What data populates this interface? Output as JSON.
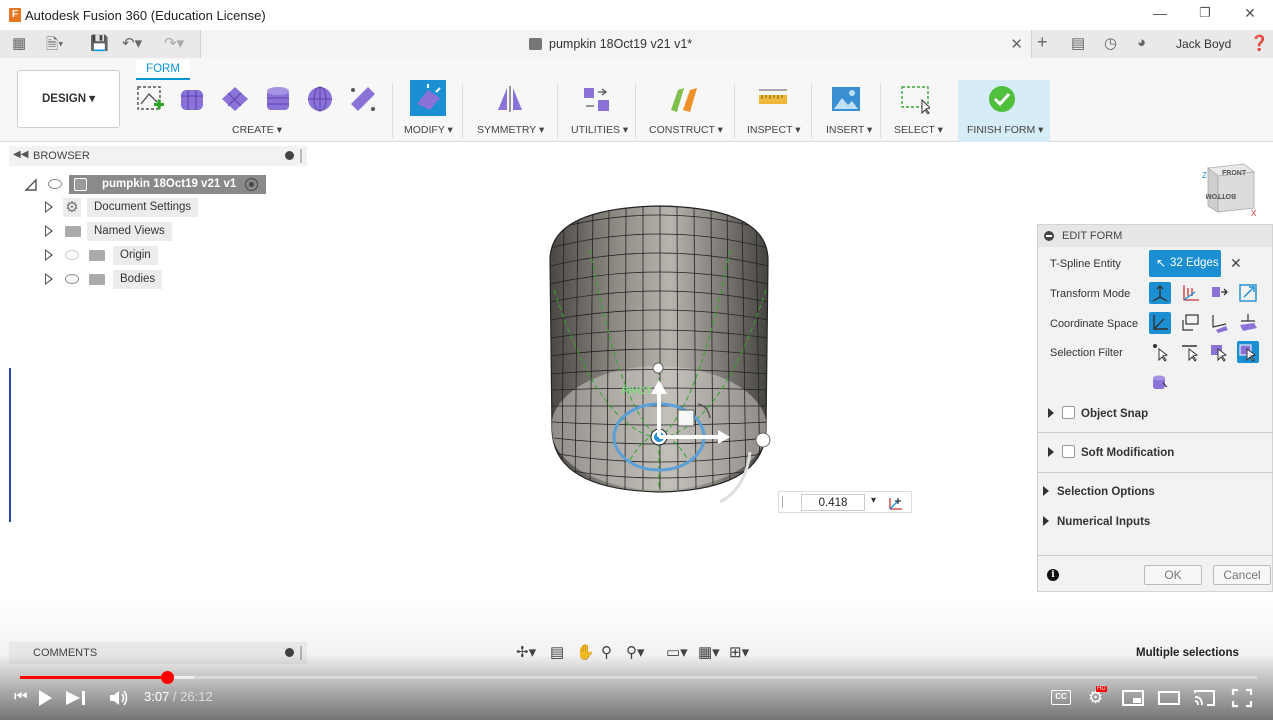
{
  "app": {
    "window_title": "Autodesk Fusion 360 (Education License)",
    "logo_letter": "F"
  },
  "tab": {
    "document_name": "pumpkin 18Oct19 v21 v1*",
    "user_name": "Jack Boyd"
  },
  "toolbar": {
    "workspace": "DESIGN ▾",
    "active_tab": "FORM",
    "groups": {
      "create": "CREATE ▾",
      "modify": "MODIFY ▾",
      "symmetry": "SYMMETRY ▾",
      "utilities": "UTILITIES ▾",
      "construct": "CONSTRUCT ▾",
      "inspect": "INSPECT ▾",
      "insert": "INSERT ▾",
      "select": "SELECT ▾",
      "finish": "FINISH FORM ▾"
    }
  },
  "browser": {
    "title": "BROWSER",
    "root": "pumpkin 18Oct19 v21 v1",
    "items": [
      {
        "label": "Document Settings"
      },
      {
        "label": "Named Views"
      },
      {
        "label": "Origin"
      },
      {
        "label": "Bodies"
      }
    ]
  },
  "viewport": {
    "pivot_label": "PIVOT",
    "input_value": "0.418"
  },
  "viewcube": {
    "front": "FRONT",
    "bottom": "BOTTOM",
    "z": "Z",
    "x": "X"
  },
  "edit_form": {
    "title": "EDIT FORM",
    "tspline_label": "T-Spline Entity",
    "tspline_value": "32 Edges",
    "transform_mode_label": "Transform Mode",
    "coordinate_space_label": "Coordinate Space",
    "selection_filter_label": "Selection Filter",
    "object_snap": "Object Snap",
    "soft_modification": "Soft Modification",
    "selection_options": "Selection Options",
    "numerical_inputs": "Numerical Inputs",
    "ok": "OK",
    "cancel": "Cancel"
  },
  "bottom": {
    "comments": "COMMENTS",
    "status": "Multiple selections"
  },
  "video": {
    "current_time": "3:07",
    "total_time": " / 26:12",
    "played_fraction": 0.119,
    "buffered_fraction": 0.141
  }
}
